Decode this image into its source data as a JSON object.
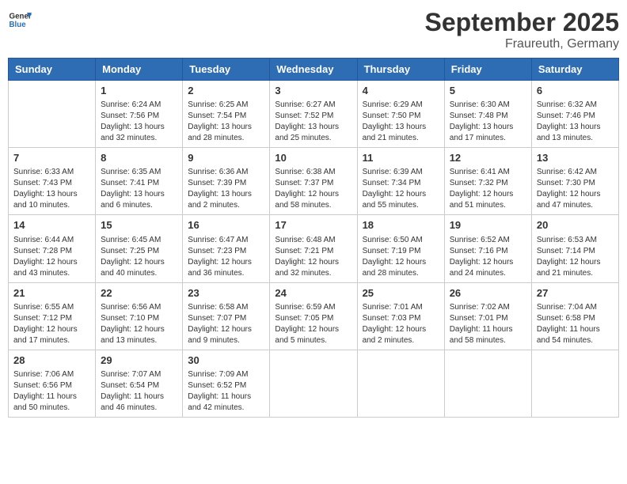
{
  "header": {
    "logo_line1": "General",
    "logo_line2": "Blue",
    "title": "September 2025",
    "subtitle": "Fraureuth, Germany"
  },
  "weekdays": [
    "Sunday",
    "Monday",
    "Tuesday",
    "Wednesday",
    "Thursday",
    "Friday",
    "Saturday"
  ],
  "weeks": [
    [
      {
        "day": "",
        "info": ""
      },
      {
        "day": "1",
        "info": "Sunrise: 6:24 AM\nSunset: 7:56 PM\nDaylight: 13 hours\nand 32 minutes."
      },
      {
        "day": "2",
        "info": "Sunrise: 6:25 AM\nSunset: 7:54 PM\nDaylight: 13 hours\nand 28 minutes."
      },
      {
        "day": "3",
        "info": "Sunrise: 6:27 AM\nSunset: 7:52 PM\nDaylight: 13 hours\nand 25 minutes."
      },
      {
        "day": "4",
        "info": "Sunrise: 6:29 AM\nSunset: 7:50 PM\nDaylight: 13 hours\nand 21 minutes."
      },
      {
        "day": "5",
        "info": "Sunrise: 6:30 AM\nSunset: 7:48 PM\nDaylight: 13 hours\nand 17 minutes."
      },
      {
        "day": "6",
        "info": "Sunrise: 6:32 AM\nSunset: 7:46 PM\nDaylight: 13 hours\nand 13 minutes."
      }
    ],
    [
      {
        "day": "7",
        "info": "Sunrise: 6:33 AM\nSunset: 7:43 PM\nDaylight: 13 hours\nand 10 minutes."
      },
      {
        "day": "8",
        "info": "Sunrise: 6:35 AM\nSunset: 7:41 PM\nDaylight: 13 hours\nand 6 minutes."
      },
      {
        "day": "9",
        "info": "Sunrise: 6:36 AM\nSunset: 7:39 PM\nDaylight: 13 hours\nand 2 minutes."
      },
      {
        "day": "10",
        "info": "Sunrise: 6:38 AM\nSunset: 7:37 PM\nDaylight: 12 hours\nand 58 minutes."
      },
      {
        "day": "11",
        "info": "Sunrise: 6:39 AM\nSunset: 7:34 PM\nDaylight: 12 hours\nand 55 minutes."
      },
      {
        "day": "12",
        "info": "Sunrise: 6:41 AM\nSunset: 7:32 PM\nDaylight: 12 hours\nand 51 minutes."
      },
      {
        "day": "13",
        "info": "Sunrise: 6:42 AM\nSunset: 7:30 PM\nDaylight: 12 hours\nand 47 minutes."
      }
    ],
    [
      {
        "day": "14",
        "info": "Sunrise: 6:44 AM\nSunset: 7:28 PM\nDaylight: 12 hours\nand 43 minutes."
      },
      {
        "day": "15",
        "info": "Sunrise: 6:45 AM\nSunset: 7:25 PM\nDaylight: 12 hours\nand 40 minutes."
      },
      {
        "day": "16",
        "info": "Sunrise: 6:47 AM\nSunset: 7:23 PM\nDaylight: 12 hours\nand 36 minutes."
      },
      {
        "day": "17",
        "info": "Sunrise: 6:48 AM\nSunset: 7:21 PM\nDaylight: 12 hours\nand 32 minutes."
      },
      {
        "day": "18",
        "info": "Sunrise: 6:50 AM\nSunset: 7:19 PM\nDaylight: 12 hours\nand 28 minutes."
      },
      {
        "day": "19",
        "info": "Sunrise: 6:52 AM\nSunset: 7:16 PM\nDaylight: 12 hours\nand 24 minutes."
      },
      {
        "day": "20",
        "info": "Sunrise: 6:53 AM\nSunset: 7:14 PM\nDaylight: 12 hours\nand 21 minutes."
      }
    ],
    [
      {
        "day": "21",
        "info": "Sunrise: 6:55 AM\nSunset: 7:12 PM\nDaylight: 12 hours\nand 17 minutes."
      },
      {
        "day": "22",
        "info": "Sunrise: 6:56 AM\nSunset: 7:10 PM\nDaylight: 12 hours\nand 13 minutes."
      },
      {
        "day": "23",
        "info": "Sunrise: 6:58 AM\nSunset: 7:07 PM\nDaylight: 12 hours\nand 9 minutes."
      },
      {
        "day": "24",
        "info": "Sunrise: 6:59 AM\nSunset: 7:05 PM\nDaylight: 12 hours\nand 5 minutes."
      },
      {
        "day": "25",
        "info": "Sunrise: 7:01 AM\nSunset: 7:03 PM\nDaylight: 12 hours\nand 2 minutes."
      },
      {
        "day": "26",
        "info": "Sunrise: 7:02 AM\nSunset: 7:01 PM\nDaylight: 11 hours\nand 58 minutes."
      },
      {
        "day": "27",
        "info": "Sunrise: 7:04 AM\nSunset: 6:58 PM\nDaylight: 11 hours\nand 54 minutes."
      }
    ],
    [
      {
        "day": "28",
        "info": "Sunrise: 7:06 AM\nSunset: 6:56 PM\nDaylight: 11 hours\nand 50 minutes."
      },
      {
        "day": "29",
        "info": "Sunrise: 7:07 AM\nSunset: 6:54 PM\nDaylight: 11 hours\nand 46 minutes."
      },
      {
        "day": "30",
        "info": "Sunrise: 7:09 AM\nSunset: 6:52 PM\nDaylight: 11 hours\nand 42 minutes."
      },
      {
        "day": "",
        "info": ""
      },
      {
        "day": "",
        "info": ""
      },
      {
        "day": "",
        "info": ""
      },
      {
        "day": "",
        "info": ""
      }
    ]
  ]
}
